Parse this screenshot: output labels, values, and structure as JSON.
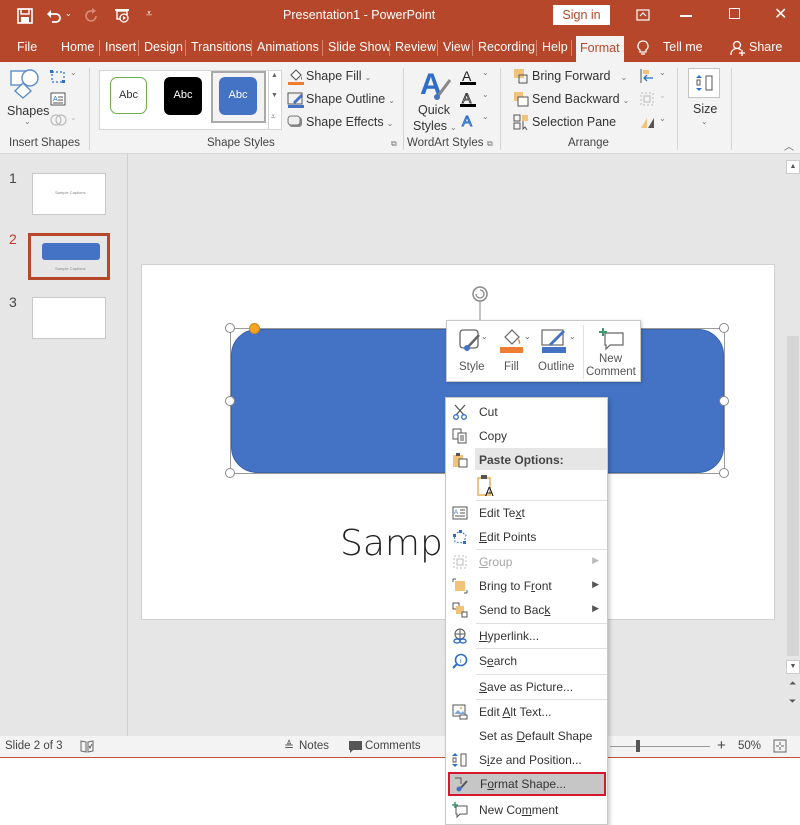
{
  "app": {
    "title": "Presentation1  -  PowerPoint",
    "sign_in": "Sign in",
    "accent": "#b7472a"
  },
  "quick_access": [
    "save-icon",
    "undo-icon",
    "redo-icon",
    "present-from-start-icon",
    "customize-icon"
  ],
  "tabs": [
    {
      "label": "File"
    },
    {
      "label": "Home"
    },
    {
      "label": "Insert"
    },
    {
      "label": "Design"
    },
    {
      "label": "Transitions"
    },
    {
      "label": "Animations"
    },
    {
      "label": "Slide Show"
    },
    {
      "label": "Review"
    },
    {
      "label": "View"
    },
    {
      "label": "Recording"
    },
    {
      "label": "Help"
    },
    {
      "label": "Format",
      "active": true
    }
  ],
  "tell_me": "Tell me",
  "share": "Share",
  "ribbon": {
    "insert_shapes": {
      "label": "Insert Shapes",
      "shapes": "Shapes"
    },
    "shape_styles": {
      "label": "Shape Styles",
      "presets": [
        "Abc",
        "Abc",
        "Abc"
      ],
      "shape_fill": "Shape Fill",
      "shape_outline": "Shape Outline",
      "shape_effects": "Shape Effects"
    },
    "wordart": {
      "label": "WordArt Styles",
      "quick": "Quick",
      "styles": "Styles"
    },
    "arrange": {
      "label": "Arrange",
      "bring_forward": "Bring Forward",
      "send_backward": "Send Backward",
      "selection_pane": "Selection Pane"
    },
    "size": {
      "label": "Size"
    }
  },
  "thumbnails": [
    {
      "num": "1",
      "caption": "Sample Captions"
    },
    {
      "num": "2",
      "caption": "Sample Captions",
      "selected": true
    },
    {
      "num": "3",
      "caption": ""
    }
  ],
  "slide": {
    "text": "Sample",
    "shape_color": "#4472c4"
  },
  "mini_toolbar": {
    "style": "Style",
    "fill": "Fill",
    "outline": "Outline",
    "new_comment_1": "New",
    "new_comment_2": "Comment"
  },
  "context_menu": {
    "cut": "Cut",
    "copy": "Copy",
    "paste_options": "Paste Options:",
    "edit_text": "Edit Text",
    "edit_points": "Edit Points",
    "group": "Group",
    "bring_to_front": "Bring to Front",
    "send_to_back": "Send to Back",
    "hyperlink": "Hyperlink...",
    "search": "Search",
    "save_as_picture": "Save as Picture...",
    "edit_alt_text": "Edit Alt Text...",
    "set_default": "Set as Default Shape",
    "size_position": "Size and Position...",
    "format_shape": "Format Shape...",
    "new_comment": "New Comment"
  },
  "status": {
    "slide_info": "Slide 2 of 3",
    "notes": "Notes",
    "comments": "Comments",
    "zoom": "50%",
    "zoom_value": 50
  }
}
